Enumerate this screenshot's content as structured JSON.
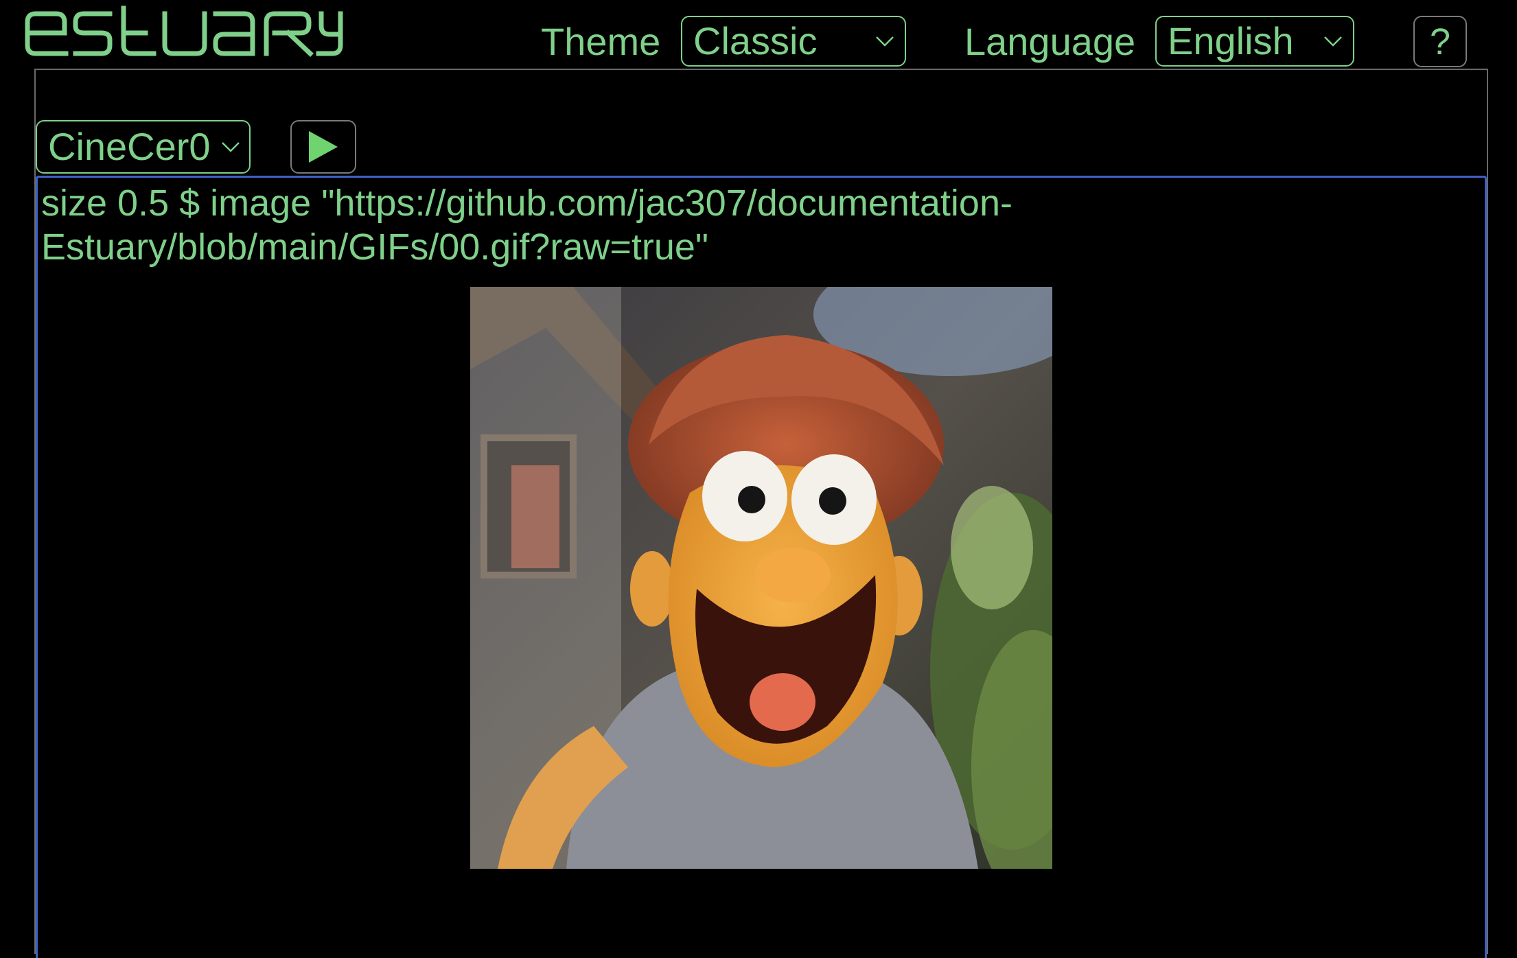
{
  "header": {
    "logo_text": "estuary",
    "theme_label": "Theme",
    "theme_value": "Classic",
    "language_label": "Language",
    "language_value": "English",
    "help_label": "?"
  },
  "toolbar": {
    "engine_value": "CineCer0",
    "run_icon": "play-icon"
  },
  "editor": {
    "code_line_1": "size 0.5 $ image \"https://github.com/jac307/documentation-",
    "code_line_2": "Estuary/blob/main/GIFs/00.gif?raw=true\""
  },
  "output": {
    "image_description": "gif-output"
  },
  "colors": {
    "accent": "#7fd08a",
    "background": "#000000",
    "editor_border": "#3f60c8",
    "button_border": "#7a7a7a"
  }
}
